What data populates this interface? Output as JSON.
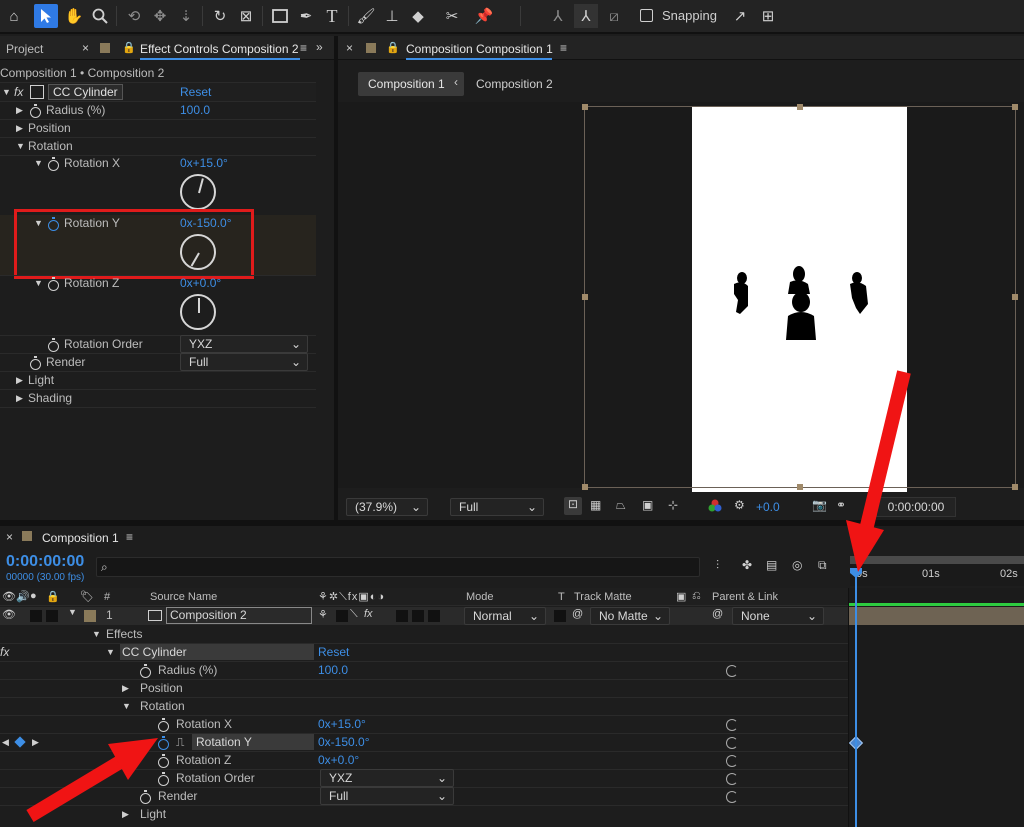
{
  "toolbar": {
    "snapping_label": "Snapping"
  },
  "left_panel": {
    "tab_project": "Project",
    "tab_effect_controls": "Effect Controls Composition 2",
    "breadcrumb": "Composition 1 • Composition 2",
    "effect_name": "CC Cylinder",
    "reset_label": "Reset",
    "props": {
      "radius_label": "Radius (%)",
      "radius_value": "100.0",
      "position_label": "Position",
      "rotation_label": "Rotation",
      "rotx_label": "Rotation X",
      "rotx_value": "0x+15.0°",
      "roty_label": "Rotation Y",
      "roty_value": "0x-150.0°",
      "rotz_label": "Rotation Z",
      "rotz_value": "0x+0.0°",
      "order_label": "Rotation Order",
      "order_value": "YXZ",
      "render_label": "Render",
      "render_value": "Full",
      "light_label": "Light",
      "shading_label": "Shading"
    }
  },
  "viewer": {
    "tab_title": "Composition Composition 1",
    "crumb_active": "Composition 1",
    "crumb_next": "Composition 2",
    "zoom_value": "(37.9%)",
    "resolution_value": "Full",
    "exposure_value": "+0.0",
    "timecode": "0:00:00:00"
  },
  "timeline": {
    "tab_title": "Composition 1",
    "current_time": "0:00:00:00",
    "frame_info": "00000 (30.00 fps)",
    "search_placeholder": "",
    "ruler": [
      "0s",
      "01s",
      "02s"
    ],
    "columns": {
      "hash": "#",
      "source_name": "Source Name",
      "mode": "Mode",
      "t": "T",
      "track_matte": "Track Matte",
      "parent_link": "Parent & Link"
    },
    "layer": {
      "number": "1",
      "name": "Composition 2",
      "mode": "Normal",
      "matte": "No Matte",
      "parent": "None"
    },
    "effects_label": "Effects",
    "effect_name": "CC Cylinder",
    "reset_label": "Reset",
    "props": {
      "radius_label": "Radius (%)",
      "radius_value": "100.0",
      "position_label": "Position",
      "rotation_label": "Rotation",
      "rotx_label": "Rotation X",
      "rotx_value": "0x+15.0°",
      "roty_label": "Rotation Y",
      "roty_value": "0x-150.0°",
      "rotz_label": "Rotation Z",
      "rotz_value": "0x+0.0°",
      "order_label": "Rotation Order",
      "order_value": "YXZ",
      "render_label": "Render",
      "render_value": "Full",
      "light_label": "Light"
    }
  },
  "colors": {
    "accent": "#3d8ee5",
    "highlight_box": "#e01b1b",
    "arrow": "#f01414",
    "playhead": "#3d8ee5",
    "green_bar": "#2ecc40"
  }
}
